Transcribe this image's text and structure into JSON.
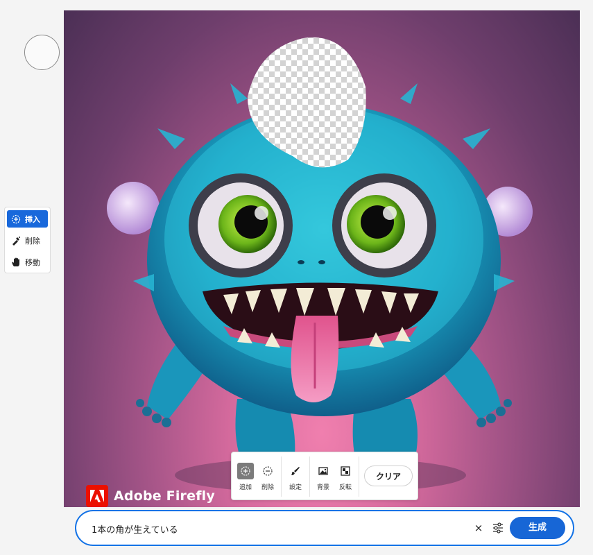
{
  "brand": {
    "name": "Adobe Firefly"
  },
  "side_toolbar": {
    "items": [
      {
        "label": "挿入",
        "icon": "insert-brush-icon",
        "active": true
      },
      {
        "label": "削除",
        "icon": "remove-brush-icon",
        "active": false
      },
      {
        "label": "移動",
        "icon": "pan-hand-icon",
        "active": false
      }
    ]
  },
  "float_toolbar": {
    "add_label": "追加",
    "subtract_label": "削除",
    "settings_label": "設定",
    "background_label": "背景",
    "invert_label": "反転",
    "clear_label": "クリア"
  },
  "prompt": {
    "value": "1本の角が生えている",
    "clear_symbol": "×",
    "generate_label": "生成"
  },
  "colors": {
    "accent": "#1473e6",
    "primary_button": "#1766d6",
    "brand_red": "#eb1000"
  }
}
